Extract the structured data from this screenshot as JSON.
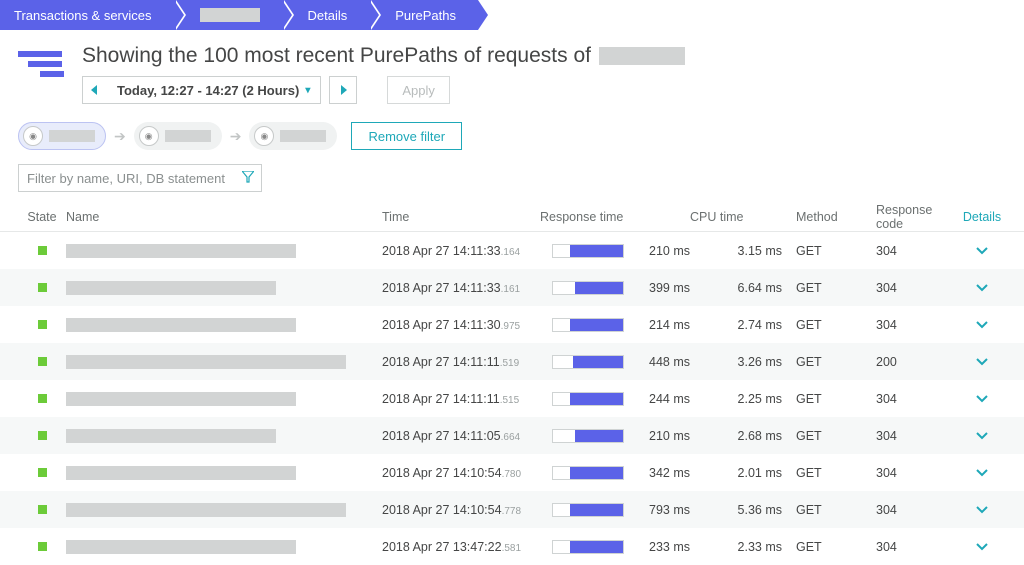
{
  "breadcrumb": [
    "Transactions & services",
    "",
    "Details",
    "PurePaths"
  ],
  "header": {
    "title_prefix": "Showing the 100 most recent PurePaths of requests of",
    "timerange": "Today, 12:27 - 14:27 (2 Hours)",
    "apply_label": "Apply"
  },
  "filterchain": {
    "remove_label": "Remove filter"
  },
  "search": {
    "placeholder": "Filter by name, URI, DB statement"
  },
  "columns": {
    "state": "State",
    "name": "Name",
    "time": "Time",
    "response_time": "Response time",
    "cpu_time": "CPU time",
    "method": "Method",
    "response_code": "Response code",
    "details": "Details"
  },
  "rows": [
    {
      "time": "2018 Apr 27 14:11:33",
      "ms3": "164",
      "rt": "210 ms",
      "rt_pct": 55,
      "cpu": "3.15 ms",
      "method": "GET",
      "code": "304",
      "nw": 230,
      "bar_off": 24
    },
    {
      "time": "2018 Apr 27 14:11:33",
      "ms3": "161",
      "rt": "399 ms",
      "rt_pct": 58,
      "cpu": "6.64 ms",
      "method": "GET",
      "code": "304",
      "nw": 210,
      "bar_off": 32
    },
    {
      "time": "2018 Apr 27 14:11:30",
      "ms3": "975",
      "rt": "214 ms",
      "rt_pct": 55,
      "cpu": "2.74 ms",
      "method": "GET",
      "code": "304",
      "nw": 230,
      "bar_off": 24
    },
    {
      "time": "2018 Apr 27 14:11:11",
      "ms3": "519",
      "rt": "448 ms",
      "rt_pct": 62,
      "cpu": "3.26 ms",
      "method": "GET",
      "code": "200",
      "nw": 280,
      "bar_off": 28
    },
    {
      "time": "2018 Apr 27 14:11:11",
      "ms3": "515",
      "rt": "244 ms",
      "rt_pct": 55,
      "cpu": "2.25 ms",
      "method": "GET",
      "code": "304",
      "nw": 230,
      "bar_off": 24
    },
    {
      "time": "2018 Apr 27 14:11:05",
      "ms3": "664",
      "rt": "210 ms",
      "rt_pct": 55,
      "cpu": "2.68 ms",
      "method": "GET",
      "code": "304",
      "nw": 210,
      "bar_off": 32
    },
    {
      "time": "2018 Apr 27 14:10:54",
      "ms3": "780",
      "rt": "342 ms",
      "rt_pct": 58,
      "cpu": "2.01 ms",
      "method": "GET",
      "code": "304",
      "nw": 230,
      "bar_off": 24
    },
    {
      "time": "2018 Apr 27 14:10:54",
      "ms3": "778",
      "rt": "793 ms",
      "rt_pct": 70,
      "cpu": "5.36 ms",
      "method": "GET",
      "code": "304",
      "nw": 280,
      "bar_off": 24
    },
    {
      "time": "2018 Apr 27 13:47:22",
      "ms3": "581",
      "rt": "233 ms",
      "rt_pct": 55,
      "cpu": "2.33 ms",
      "method": "GET",
      "code": "304",
      "nw": 230,
      "bar_off": 24
    }
  ]
}
